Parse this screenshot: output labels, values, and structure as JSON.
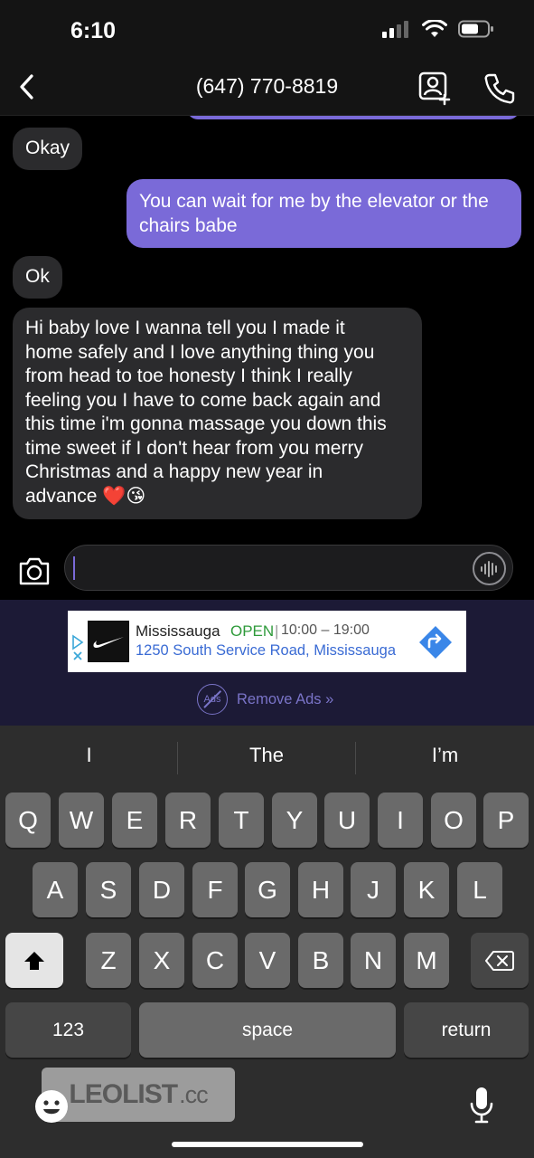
{
  "status_bar": {
    "time": "6:10"
  },
  "nav": {
    "title": "(647) 770-8819"
  },
  "messages": [
    {
      "direction": "in",
      "text": "Okay"
    },
    {
      "direction": "out",
      "lines": [
        "You can wait for me by the elevator or the",
        "chairs babe"
      ]
    },
    {
      "direction": "in",
      "text": "Ok"
    },
    {
      "direction": "in",
      "lines": [
        "Hi baby love I wanna tell you I made it",
        "home safely and I love anything thing you",
        "from head to toe honesty I think I really",
        "feeling you I have to come back again and",
        "this time i'm gonna massage you down this",
        "time sweet if I don't hear from you merry",
        "Christmas and a happy new year in",
        "advance ❤️😘"
      ]
    }
  ],
  "composer": {
    "value": ""
  },
  "ad": {
    "name": "Mississauga",
    "status": "OPEN",
    "separator": "|",
    "hours": "10:00 – 19:00",
    "address": "1250 South Service Road, Mississauga",
    "remove_ads_icon_text": "Ads",
    "remove_ads_label": "Remove Ads »"
  },
  "keyboard": {
    "suggestions": [
      "I",
      "The",
      "I’m"
    ],
    "row1": [
      "Q",
      "W",
      "E",
      "R",
      "T",
      "Y",
      "U",
      "I",
      "O",
      "P"
    ],
    "row2": [
      "A",
      "S",
      "D",
      "F",
      "G",
      "H",
      "J",
      "K",
      "L"
    ],
    "row3": [
      "Z",
      "X",
      "C",
      "V",
      "B",
      "N",
      "M"
    ],
    "numbers_key": "123",
    "space_key": "space",
    "return_key": "return"
  },
  "watermark": {
    "main": "LEOLIST",
    "suffix": ".cc"
  },
  "colors": {
    "outgoing_bubble": "#7a6ad8",
    "incoming_bubble": "#2b2b2d",
    "ad_background": "#1c1a36"
  }
}
